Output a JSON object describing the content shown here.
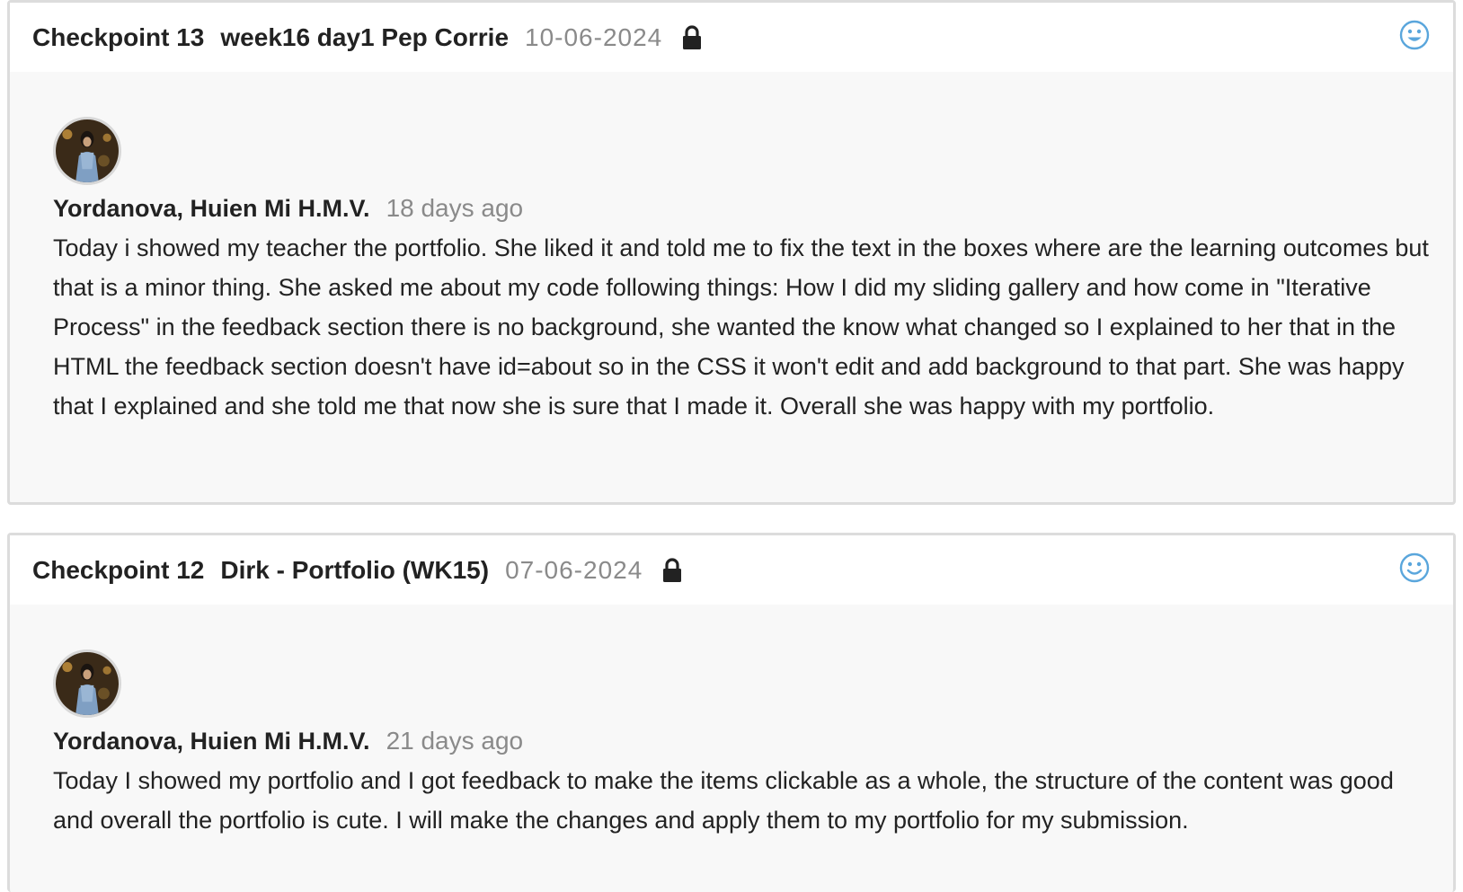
{
  "checkpoints": [
    {
      "number": "Checkpoint 13",
      "title": "week16 day1 Pep Corrie",
      "date": "10-06-2024",
      "lock_icon": "lock-icon",
      "reaction_icon": "smiley-icon",
      "comment": {
        "author": "Yordanova, Huien Mi H.M.V.",
        "time_ago": "18 days ago",
        "text": "Today i showed my teacher the portfolio. She liked it and told me to fix the text in the boxes where are the learning outcomes but that is a minor thing. She asked me about my code following things: How I did my sliding gallery and how come in \"Iterative Process\" in the feedback section there is no background, she wanted the know what changed so I explained to her that in the HTML the feedback section doesn't have id=about so in the CSS it won't edit and add background to that part. She was happy that I explained and she told me that now she is sure that I made it. Overall she was happy with my portfolio."
      }
    },
    {
      "number": "Checkpoint 12",
      "title": "Dirk - Portfolio (WK15)",
      "date": "07-06-2024",
      "lock_icon": "lock-icon",
      "reaction_icon": "smiley-icon",
      "comment": {
        "author": "Yordanova, Huien Mi H.M.V.",
        "time_ago": "21 days ago",
        "text": "Today I showed my portfolio and I got feedback to make the items clickable as a whole, the structure of the content was good and overall the portfolio is cute. I will make the changes and apply them to my portfolio for my submission."
      }
    }
  ],
  "colors": {
    "accent_icon": "#5aa6dc",
    "muted_text": "#8a8a8a",
    "card_bg": "#f8f8f8",
    "border": "#dcdcdc"
  }
}
